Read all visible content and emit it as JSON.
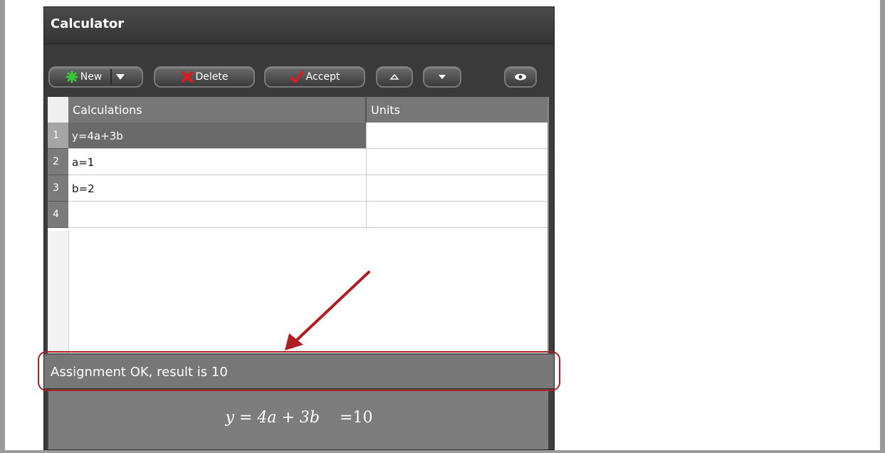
{
  "window": {
    "title": "Calculator"
  },
  "toolbar": {
    "new_label": "New",
    "delete_label": "Delete",
    "accept_label": "Accept"
  },
  "table": {
    "columns": [
      "Calculations",
      "Units"
    ],
    "rows": [
      {
        "num": "1",
        "calc": "y=4a+3b",
        "units": ""
      },
      {
        "num": "2",
        "calc": "a=1",
        "units": ""
      },
      {
        "num": "3",
        "calc": "b=2",
        "units": ""
      },
      {
        "num": "4",
        "calc": "",
        "units": ""
      }
    ]
  },
  "status": {
    "text": "Assignment OK, result is 10"
  },
  "formula": {
    "expression": "y = 4a + 3b",
    "result": "=10"
  },
  "colors": {
    "callout": "#b01e23",
    "window_bg": "#3c3c3c",
    "header_bg": "#777777"
  }
}
